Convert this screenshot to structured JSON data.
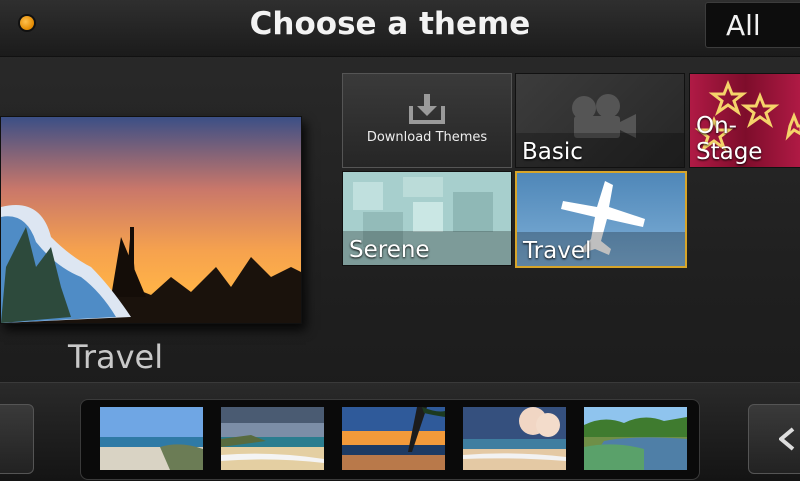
{
  "header": {
    "title": "Choose a theme",
    "filter_label": "All"
  },
  "preview": {
    "theme_name": "Travel"
  },
  "themes": {
    "download": "Download Themes",
    "basic": "Basic",
    "on_stage": "On-Stage",
    "serene": "Serene",
    "travel": "Travel"
  },
  "colors": {
    "accent": "#f0a400",
    "selected_border": "#d7a52a"
  }
}
